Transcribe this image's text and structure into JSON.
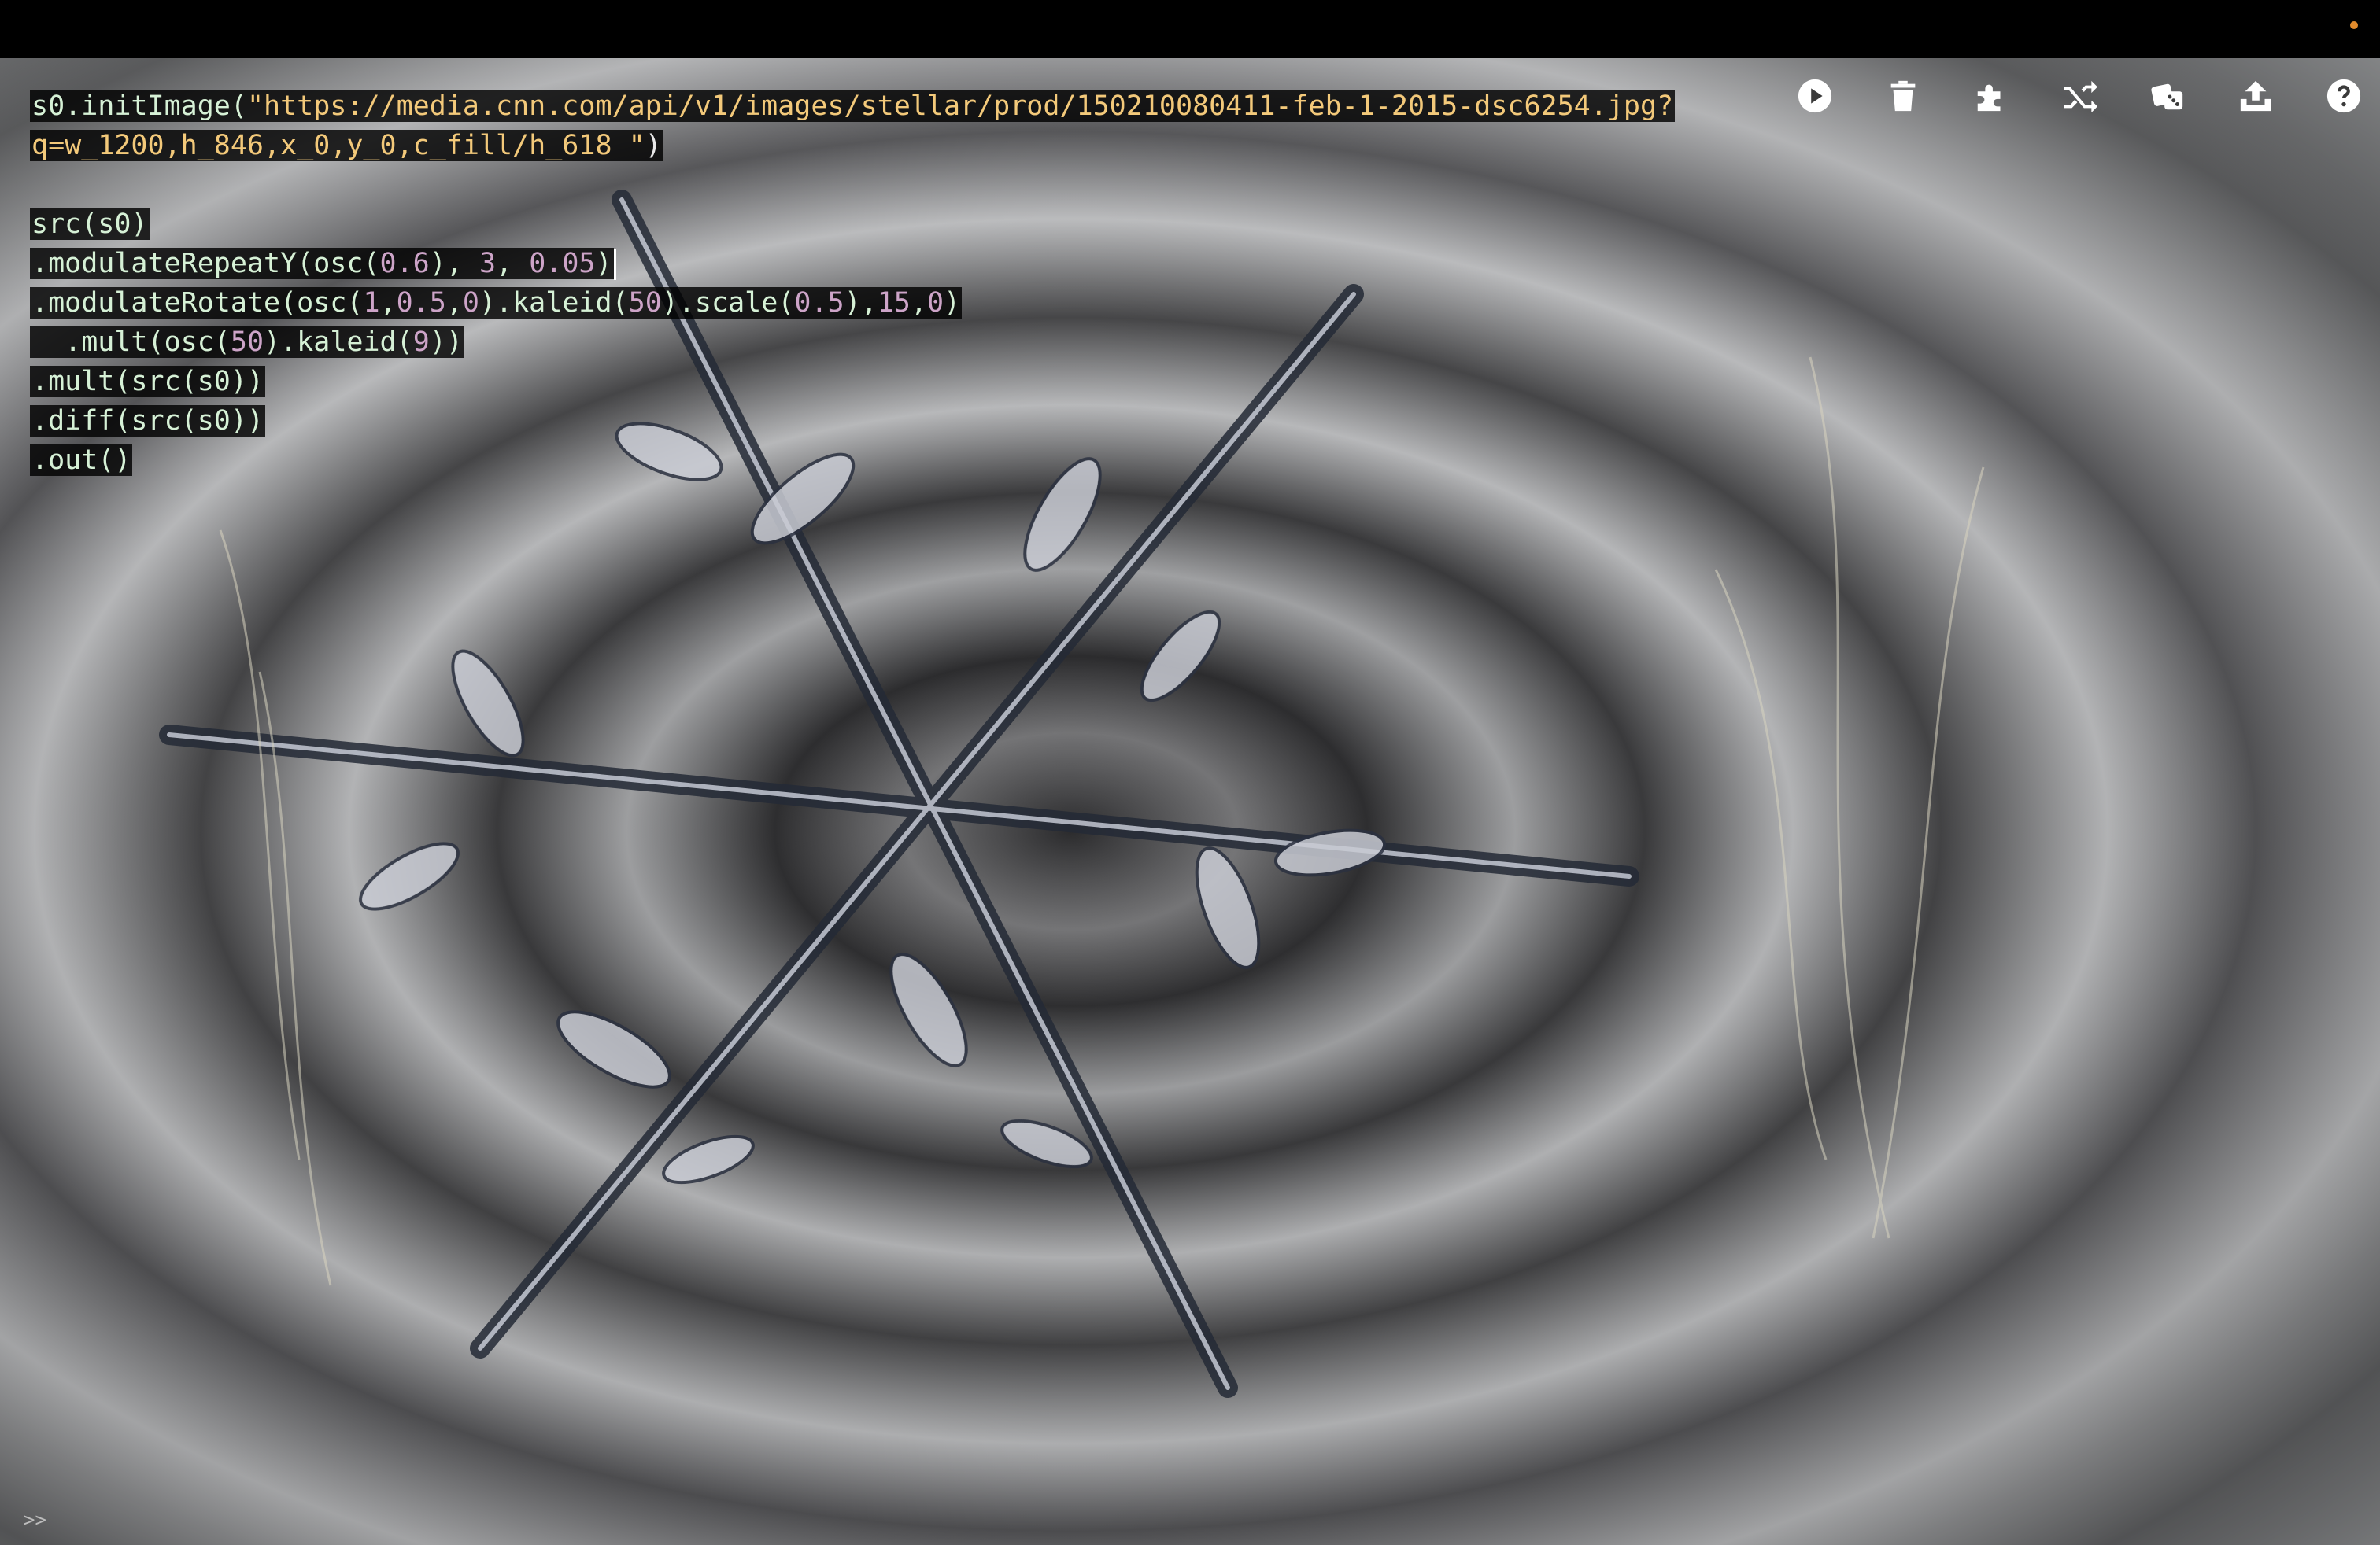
{
  "toolbar": {
    "buttons": [
      {
        "name": "run",
        "icon": "play-icon"
      },
      {
        "name": "clear",
        "icon": "trash-icon"
      },
      {
        "name": "extensions",
        "icon": "puzzle-icon"
      },
      {
        "name": "shuffle",
        "icon": "shuffle-icon"
      },
      {
        "name": "random",
        "icon": "dice-icon"
      },
      {
        "name": "upload",
        "icon": "upload-icon"
      },
      {
        "name": "help",
        "icon": "help-icon"
      }
    ]
  },
  "editor": {
    "line1_prefix": "s0.initImage(",
    "line1_string": "\"https://media.cnn.com/api/v1/images/stellar/prod/150210080411-feb-1-2015-dsc6254.jpg?",
    "line2_string": "q=w_1200,h_846,x_0,y_0,c_fill/h_618 \"",
    "line2_suffix": ")",
    "line3": "src(s0)",
    "line4_a": ".modulateRepeatY(osc(",
    "line4_n1": "0.6",
    "line4_b": "), ",
    "line4_n2": "3",
    "line4_c": ", ",
    "line4_n3": "0.05",
    "line4_d": ")",
    "line5_a": ".modulateRotate(osc(",
    "line5_n1": "1",
    "line5_c1": ",",
    "line5_n2": "0.5",
    "line5_c2": ",",
    "line5_n3": "0",
    "line5_b": ").kaleid(",
    "line5_n4": "50",
    "line5_c": ").scale(",
    "line5_n5": "0.5",
    "line5_d": "),",
    "line5_n6": "15",
    "line5_c3": ",",
    "line5_n7": "0",
    "line5_e": ")",
    "line6_a": "  .mult(osc(",
    "line6_n1": "50",
    "line6_b": ").kaleid(",
    "line6_n2": "9",
    "line6_c": "))",
    "line7": ".mult(src(s0))",
    "line8": ".diff(src(s0))",
    "line9": ".out()"
  },
  "console": {
    "prompt": ">>"
  },
  "colors": {
    "string": "#f3c97a",
    "number": "#cda4c8",
    "status_dot": "#e08a2c"
  }
}
